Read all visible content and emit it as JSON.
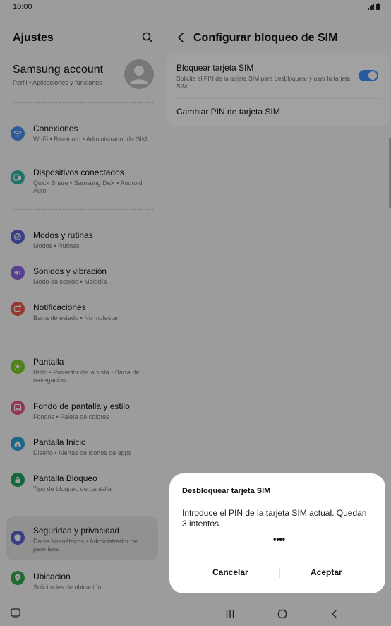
{
  "status": {
    "time": "10:00"
  },
  "left": {
    "title": "Ajustes",
    "account": {
      "name": "Samsung account",
      "sub": "Perfil  •  Aplicaciones y funciones"
    },
    "items": [
      {
        "title": "Conexiones",
        "sub": "Wi-Fi  •  Bluetooth  •  Administrador de SIM",
        "icon": "wifi-icon",
        "color": "#4a8ff0"
      },
      {
        "title": "Dispositivos conectados",
        "sub": "Quick Share  •  Samsung DeX  •  Android Auto",
        "icon": "connected-devices-icon",
        "color": "#2fb5a8"
      },
      {
        "title": "Modos y rutinas",
        "sub": "Modos  •  Rutinas",
        "icon": "modes-icon",
        "color": "#5b63d6"
      },
      {
        "title": "Sonidos y vibración",
        "sub": "Modo de sonido  •  Melodía",
        "icon": "sound-icon",
        "color": "#8a66e0"
      },
      {
        "title": "Notificaciones",
        "sub": "Barra de estado  •  No molestar",
        "icon": "notification-icon",
        "color": "#ef5b4f"
      },
      {
        "title": "Pantalla",
        "sub": "Brillo  •  Protector de la vista  •  Barra de navegación",
        "icon": "display-icon",
        "color": "#7ccf28"
      },
      {
        "title": "Fondo de pantalla y estilo",
        "sub": "Fondos  •  Paleta de colores",
        "icon": "wallpaper-icon",
        "color": "#e8528c"
      },
      {
        "title": "Pantalla Inicio",
        "sub": "Diseño  •  Alertas de iconos de apps",
        "icon": "home-icon",
        "color": "#2aa2d8"
      },
      {
        "title": "Pantalla Bloqueo",
        "sub": "Tipo de bloqueo de pantalla",
        "icon": "lock-icon",
        "color": "#21a461"
      },
      {
        "title": "Seguridad y privacidad",
        "sub": "Datos biométricos  •  Administrador de permisos",
        "icon": "shield-icon",
        "color": "#5b63d6"
      },
      {
        "title": "Ubicación",
        "sub": "Solicitudes de ubicación",
        "icon": "location-icon",
        "color": "#33a853"
      }
    ]
  },
  "right": {
    "title": "Configurar bloqueo de SIM",
    "lock_sim": {
      "title": "Bloquear tarjeta SIM",
      "sub": "Solicita el PIN de la tarjeta SIM para desbloquear y usar la tarjeta SIM.",
      "enabled": true
    },
    "change_pin": "Cambiar PIN de tarjeta SIM"
  },
  "dialog": {
    "title": "Desbloquear tarjeta SIM",
    "message": "Introduce el PIN de la tarjeta SIM actual. Quedan 3 intentos.",
    "pin_value": "••••",
    "cancel": "Cancelar",
    "accept": "Aceptar"
  },
  "colors": {
    "accent": "#3e91ff",
    "scrim": "rgba(0,0,0,0.37)"
  }
}
